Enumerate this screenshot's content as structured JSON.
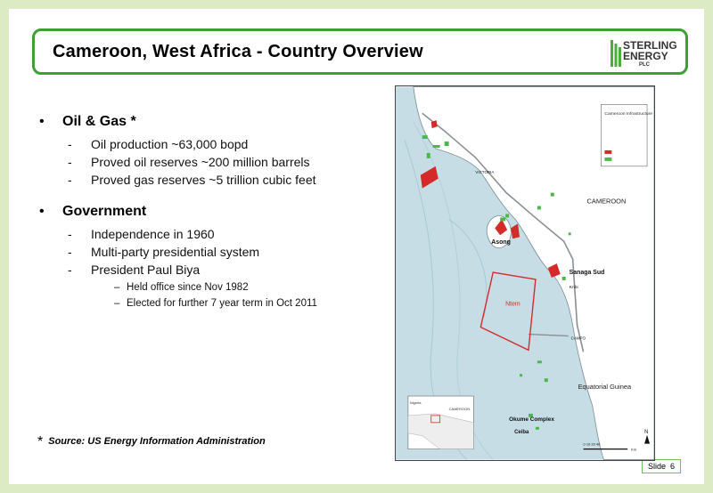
{
  "title": "Cameroon, West Africa - Country Overview",
  "logo": {
    "line1": "STERLING",
    "line2": "ENERGY",
    "line3": "PLC"
  },
  "sections": [
    {
      "heading": "Oil & Gas *",
      "items": [
        {
          "text": "Oil production ~63,000 bopd"
        },
        {
          "text": "Proved oil reserves ~200 million barrels"
        },
        {
          "text": "Proved gas reserves ~5 trillion cubic feet"
        }
      ]
    },
    {
      "heading": "Government",
      "items": [
        {
          "text": "Independence in 1960"
        },
        {
          "text": "Multi-party presidential system"
        },
        {
          "text": "President Paul Biya",
          "subitems": [
            "Held office since Nov 1982",
            "Elected for further 7 year term in Oct 2011"
          ]
        }
      ]
    }
  ],
  "source": {
    "star": "*",
    "text": "Source: US Energy Information Administration"
  },
  "slide_number": {
    "label": "Slide",
    "number": "6"
  },
  "map": {
    "labels": {
      "cameroon": "CAMEROON",
      "equatorial_guinea": "Equatorial Guinea",
      "asong": "Asong",
      "sanaga_sud": "Sanaga Sud",
      "kribi": "Kribi",
      "ntem": "Ntem",
      "okume_complex": "Okume Complex",
      "ceiba": "Ceiba",
      "campo": "CAMPO",
      "victoria": "VICTORIA",
      "north": "N",
      "legend_title": "Cameroon Infrastructure",
      "inset_country": "CAMEROON",
      "inset_nigeria": "Nigeria",
      "scale": "0  10  20     40",
      "scale_unit": "Km"
    },
    "colors": {
      "block_red": "#d42a2a",
      "field_green": "#4bb848",
      "sea": "#c6dde6",
      "land": "#ffffff"
    }
  }
}
